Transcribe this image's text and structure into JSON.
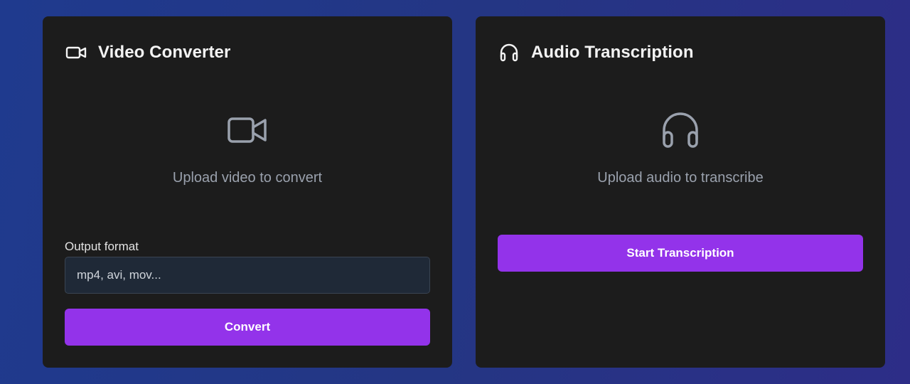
{
  "video_converter": {
    "title": "Video Converter",
    "icon": "video-camera-icon",
    "upload_text": "Upload video to convert",
    "output_format_label": "Output format",
    "output_format_placeholder": "mp4, avi, mov...",
    "output_format_value": "",
    "convert_label": "Convert"
  },
  "audio_transcription": {
    "title": "Audio Transcription",
    "icon": "headphones-icon",
    "upload_text": "Upload audio to transcribe",
    "start_label": "Start Transcription"
  },
  "colors": {
    "background_start": "#1f3a8e",
    "background_end": "#2d2d87",
    "card": "#1c1c1c",
    "accent": "#9333ea",
    "muted_text": "#9aa1ad",
    "input_bg": "#1f2937"
  }
}
